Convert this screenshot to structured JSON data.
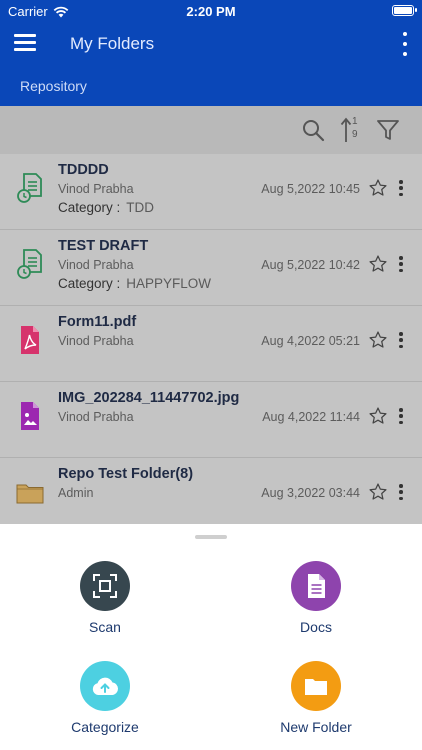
{
  "status_bar": {
    "carrier": "Carrier",
    "time": "2:20 PM"
  },
  "header": {
    "title": "My Folders",
    "breadcrumb": "Repository"
  },
  "toolbar": {
    "sort_glyph_top": "1",
    "sort_glyph_bottom": "9"
  },
  "category_label": "Category :",
  "items": [
    {
      "name": "TDDDD",
      "owner": "Vinod Prabha",
      "date": "Aug 5,2022 10:45",
      "category": "TDD",
      "icon": "draft-doc-icon"
    },
    {
      "name": "TEST DRAFT",
      "owner": "Vinod Prabha",
      "date": "Aug 5,2022 10:42",
      "category": "HAPPYFLOW",
      "icon": "draft-doc-icon"
    },
    {
      "name": "Form11.pdf",
      "owner": "Vinod Prabha",
      "date": "Aug 4,2022 05:21",
      "icon": "pdf-icon"
    },
    {
      "name": "IMG_202284_11447702.jpg",
      "owner": "Vinod Prabha",
      "date": "Aug 4,2022 11:44",
      "icon": "image-file-icon"
    },
    {
      "name": "Repo Test Folder(8)",
      "owner": "Admin",
      "date": "Aug 3,2022 03:44",
      "icon": "folder-icon"
    }
  ],
  "actions": [
    {
      "label": "Scan",
      "color": "#37474f",
      "icon": "scan-icon"
    },
    {
      "label": "Docs",
      "color": "#8e44ad",
      "icon": "docs-icon"
    },
    {
      "label": "Categorize",
      "color": "#4dd0e1",
      "icon": "cloud-upload-icon"
    },
    {
      "label": "New Folder",
      "color": "#f39c12",
      "icon": "new-folder-icon"
    }
  ],
  "colors": {
    "brand": "#0a47b8",
    "draft_icon": "#2e8b57",
    "pdf_icon": "#d6336c",
    "image_icon": "#9c27b0",
    "folder_icon": "#c9a25a"
  }
}
